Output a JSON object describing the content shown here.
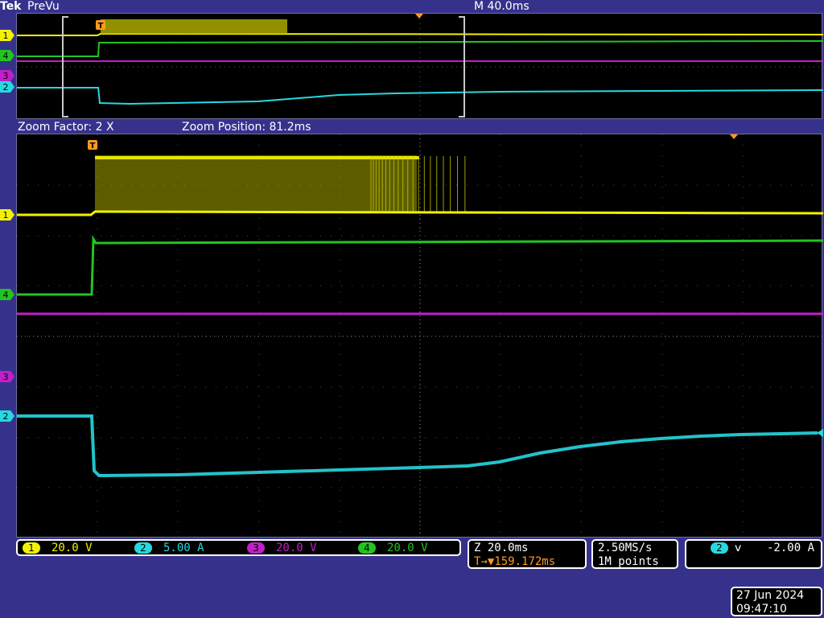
{
  "header": {
    "brand": "Tek",
    "mode": "PreVu",
    "timebase": "M 40.0ms"
  },
  "zoom": {
    "factor_label": "Zoom Factor: 2 X",
    "position_label": "Zoom Position: 81.2ms"
  },
  "markers": {
    "trigger": "T",
    "channels": [
      "1",
      "4",
      "3",
      "2"
    ]
  },
  "vertical": [
    {
      "channel": "1",
      "scale": "20.0 V",
      "color": "#f2f200"
    },
    {
      "channel": "2",
      "scale": "5.00 A",
      "color": "#27d8e0"
    },
    {
      "channel": "3",
      "scale": "20.0 V",
      "color": "#c21ec9"
    },
    {
      "channel": "4",
      "scale": "20.0 V",
      "color": "#22c422"
    }
  ],
  "horizontal": {
    "scale": "Z 20.0ms",
    "trigger_pos_icon": "T→▼",
    "trigger_pos": "159.172ms"
  },
  "acquisition": {
    "sample_rate": "2.50MS/s",
    "record_length": "1M points"
  },
  "trigger": {
    "source": "2",
    "slope_icon": "falling-edge-icon",
    "slope_glyph": "ⅴ",
    "level": "-2.00 A"
  },
  "datetime": {
    "date": "27 Jun 2024",
    "time": "09:47:10"
  },
  "colors": {
    "background": "#36328c",
    "ch1": "#f2f200",
    "ch2": "#27d8e0",
    "ch3": "#c21ec9",
    "ch4": "#22c422",
    "trigger_marker": "#ff9a1e",
    "graticule": "#6a6a6a"
  }
}
